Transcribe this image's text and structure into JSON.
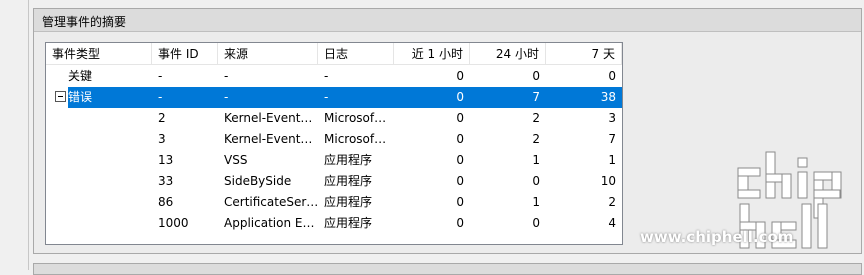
{
  "panel": {
    "title": "管理事件的摘要"
  },
  "columns": [
    "事件类型",
    "事件 ID",
    "来源",
    "日志",
    "近 1 小时",
    "24 小时",
    "7 天"
  ],
  "rows": [
    {
      "type": "关键",
      "id": "-",
      "source": "-",
      "log": "-",
      "h1": "0",
      "h24": "0",
      "d7": "0",
      "expanded": false,
      "selected": false
    },
    {
      "type": "错误",
      "id": "-",
      "source": "-",
      "log": "-",
      "h1": "0",
      "h24": "7",
      "d7": "38",
      "expanded": true,
      "selected": true
    },
    {
      "type": "",
      "id": "2",
      "source": "Kernel-Event…",
      "log": "Microsof…",
      "h1": "0",
      "h24": "2",
      "d7": "3"
    },
    {
      "type": "",
      "id": "3",
      "source": "Kernel-Event…",
      "log": "Microsof…",
      "h1": "0",
      "h24": "2",
      "d7": "7"
    },
    {
      "type": "",
      "id": "13",
      "source": "VSS",
      "log": "应用程序",
      "h1": "0",
      "h24": "1",
      "d7": "1"
    },
    {
      "type": "",
      "id": "33",
      "source": "SideBySide",
      "log": "应用程序",
      "h1": "0",
      "h24": "0",
      "d7": "10"
    },
    {
      "type": "",
      "id": "86",
      "source": "CertificateSer…",
      "log": "应用程序",
      "h1": "0",
      "h24": "1",
      "d7": "2"
    },
    {
      "type": "",
      "id": "1000",
      "source": "Application E…",
      "log": "应用程序",
      "h1": "0",
      "h24": "0",
      "d7": "4"
    }
  ],
  "watermark": {
    "url": "www.chiphell.com",
    "logo_text": "chip hell"
  },
  "colors": {
    "selection": "#0078d7",
    "panel_header": "#dcdcdc"
  }
}
